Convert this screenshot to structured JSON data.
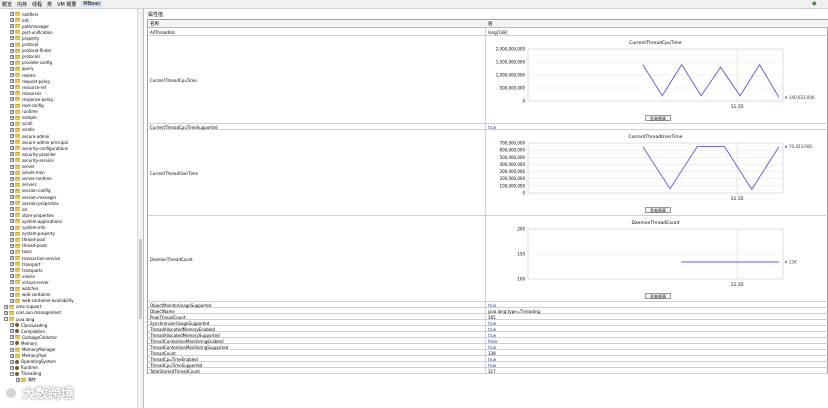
{
  "menu": {
    "items": [
      "概览",
      "内存",
      "线程",
      "类",
      "VM 概要",
      "MBean"
    ],
    "active": "MBean"
  },
  "tree": {
    "items": [
      {
        "label": "notifiers",
        "type": "folder",
        "depth": 1
      },
      {
        "label": "orb",
        "type": "folder",
        "depth": 1
      },
      {
        "label": "pathmanager",
        "type": "folder",
        "depth": 1
      },
      {
        "label": "port-unification",
        "type": "folder",
        "depth": 1
      },
      {
        "label": "property",
        "type": "folder",
        "depth": 1
      },
      {
        "label": "protocol",
        "type": "folder",
        "depth": 1
      },
      {
        "label": "protocol-finder",
        "type": "folder",
        "depth": 1
      },
      {
        "label": "protocols",
        "type": "folder",
        "depth": 1
      },
      {
        "label": "provider-config",
        "type": "folder",
        "depth": 1
      },
      {
        "label": "query",
        "type": "folder",
        "depth": 1
      },
      {
        "label": "realms",
        "type": "folder",
        "depth": 1
      },
      {
        "label": "request-policy",
        "type": "folder",
        "depth": 1
      },
      {
        "label": "resource-ref",
        "type": "folder",
        "depth": 1
      },
      {
        "label": "resources",
        "type": "folder",
        "depth": 1
      },
      {
        "label": "response-policy",
        "type": "folder",
        "depth": 1
      },
      {
        "label": "root-config",
        "type": "folder",
        "depth": 1
      },
      {
        "label": "runtime",
        "type": "folder",
        "depth": 1
      },
      {
        "label": "sample",
        "type": "folder",
        "depth": 1
      },
      {
        "label": "scroll",
        "type": "folder",
        "depth": 1
      },
      {
        "label": "scrolls",
        "type": "folder",
        "depth": 1
      },
      {
        "label": "secure-admin",
        "type": "folder",
        "depth": 1
      },
      {
        "label": "secure-admin-principal",
        "type": "folder",
        "depth": 1
      },
      {
        "label": "security-configurations",
        "type": "folder",
        "depth": 1
      },
      {
        "label": "security-provider",
        "type": "folder",
        "depth": 1
      },
      {
        "label": "security-service",
        "type": "folder",
        "depth": 1
      },
      {
        "label": "server",
        "type": "folder",
        "depth": 1
      },
      {
        "label": "server-mon",
        "type": "folder",
        "depth": 1
      },
      {
        "label": "server-runtime",
        "type": "folder",
        "depth": 1
      },
      {
        "label": "servers",
        "type": "folder",
        "depth": 1
      },
      {
        "label": "session-config",
        "type": "folder",
        "depth": 1
      },
      {
        "label": "session-manager",
        "type": "folder",
        "depth": 1
      },
      {
        "label": "session-properties",
        "type": "folder",
        "depth": 1
      },
      {
        "label": "ssl",
        "type": "folder",
        "depth": 1
      },
      {
        "label": "store-properties",
        "type": "folder",
        "depth": 1
      },
      {
        "label": "system-applications",
        "type": "folder",
        "depth": 1
      },
      {
        "label": "system-info",
        "type": "folder",
        "depth": 1
      },
      {
        "label": "system-property",
        "type": "folder",
        "depth": 1
      },
      {
        "label": "thread-pool",
        "type": "folder",
        "depth": 1
      },
      {
        "label": "thread-pools",
        "type": "folder",
        "depth": 1
      },
      {
        "label": "tools",
        "type": "folder",
        "depth": 1
      },
      {
        "label": "transaction-service",
        "type": "folder",
        "depth": 1
      },
      {
        "label": "transport",
        "type": "folder",
        "depth": 1
      },
      {
        "label": "transports",
        "type": "folder",
        "depth": 1
      },
      {
        "label": "valves",
        "type": "folder",
        "depth": 1
      },
      {
        "label": "virtual-server",
        "type": "folder",
        "depth": 1
      },
      {
        "label": "watches",
        "type": "folder",
        "depth": 1
      },
      {
        "label": "web-container",
        "type": "folder",
        "depth": 1
      },
      {
        "label": "web-container-availability",
        "type": "folder",
        "depth": 1
      },
      {
        "label": "amx-support",
        "type": "folder",
        "depth": 0
      },
      {
        "label": "com.sun.management",
        "type": "folder",
        "depth": 0
      },
      {
        "label": "java.lang",
        "type": "folder",
        "depth": 0,
        "open": true
      },
      {
        "label": "ClassLoading",
        "type": "bean",
        "depth": 1
      },
      {
        "label": "Compilation",
        "type": "bean",
        "depth": 1
      },
      {
        "label": "GarbageCollector",
        "type": "folder",
        "depth": 1
      },
      {
        "label": "Memory",
        "type": "bean",
        "depth": 1
      },
      {
        "label": "MemoryManager",
        "type": "folder",
        "depth": 1
      },
      {
        "label": "MemoryPool",
        "type": "folder",
        "depth": 1
      },
      {
        "label": "OperatingSystem",
        "type": "bean",
        "depth": 1
      },
      {
        "label": "Runtime",
        "type": "bean",
        "depth": 1
      },
      {
        "label": "Threading",
        "type": "bean",
        "depth": 1,
        "open": true
      },
      {
        "label": "属性",
        "type": "folder",
        "depth": 2
      }
    ]
  },
  "panel": {
    "title": "属性值",
    "col_name": "名称",
    "col_value": "值",
    "chart_button": "discard_chart"
  },
  "labels": {
    "discard_chart": "丢弃图表"
  },
  "rows": [
    {
      "name": "AllThreadIds",
      "value": "long[138]",
      "kind": "text"
    },
    {
      "name": "CurrentThreadCpuTime",
      "kind": "chart",
      "chart_index": 0
    },
    {
      "name": "CurrentThreadCpuTimeSupported",
      "value": "true",
      "kind": "bool"
    },
    {
      "name": "CurrentThreadUserTime",
      "kind": "chart",
      "chart_index": 1
    },
    {
      "name": "DaemonThreadCount",
      "kind": "chart",
      "chart_index": 2
    },
    {
      "name": "ObjectMonitorUsageSupported",
      "value": "true",
      "kind": "bool"
    },
    {
      "name": "ObjectName",
      "value": "java.lang:type=Threading",
      "kind": "text"
    },
    {
      "name": "PeakThreadCount",
      "value": "165",
      "kind": "text"
    },
    {
      "name": "SynchronizerUsageSupported",
      "value": "true",
      "kind": "bool"
    },
    {
      "name": "ThreadAllocatedMemoryEnabled",
      "value": "true",
      "kind": "bool"
    },
    {
      "name": "ThreadAllocatedMemorySupported",
      "value": "true",
      "kind": "bool"
    },
    {
      "name": "ThreadContentionMonitoringEnabled",
      "value": "false",
      "kind": "bool"
    },
    {
      "name": "ThreadContentionMonitoringSupported",
      "value": "true",
      "kind": "bool"
    },
    {
      "name": "ThreadCount",
      "value": "138",
      "kind": "text"
    },
    {
      "name": "ThreadCpuTimeEnabled",
      "value": "true",
      "kind": "bool"
    },
    {
      "name": "ThreadCpuTimeSupported",
      "value": "true",
      "kind": "bool"
    },
    {
      "name": "TotalStartedThreadCount",
      "value": "317",
      "kind": "text"
    }
  ],
  "chart_data": [
    {
      "type": "line",
      "title": "CurrentThreadCpuTime",
      "ylim": [
        0,
        2000000000
      ],
      "yticks": [
        "2,000,000,000",
        "1,500,000,000",
        "1,000,000,000",
        "500,000,000",
        "0"
      ],
      "xtick": "11:35",
      "x": [
        0,
        1,
        2,
        3,
        4,
        5,
        6,
        7
      ],
      "y": [
        1400000000,
        200000000,
        1400000000,
        200000000,
        1300000000,
        200000000,
        1400000000,
        140000000
      ],
      "current_label": "140,623,000",
      "color": "#5b5bd6"
    },
    {
      "type": "line",
      "title": "CurrentThreadUserTime",
      "ylim": [
        0,
        700000000
      ],
      "yticks": [
        "700,000,000",
        "600,000,000",
        "500,000,000",
        "400,000,000",
        "300,000,000",
        "200,000,000",
        "100,000,000",
        "0"
      ],
      "xtick": "11:35",
      "x": [
        0,
        1,
        2,
        3,
        4,
        5
      ],
      "y": [
        650000000,
        60000000,
        650000000,
        650000000,
        50000000,
        650000000
      ],
      "current_label": "70,423,000",
      "color": "#5b5bd6"
    },
    {
      "type": "line",
      "title": "DaemonThreadCount",
      "ylim": [
        100,
        200
      ],
      "yticks": [
        "200",
        "150",
        "100"
      ],
      "xtick": "11:35",
      "x": [
        0,
        1
      ],
      "y": [
        134,
        134
      ],
      "current_label": "134",
      "color": "#5b5bd6"
    }
  ],
  "watermark": "大数跨境"
}
